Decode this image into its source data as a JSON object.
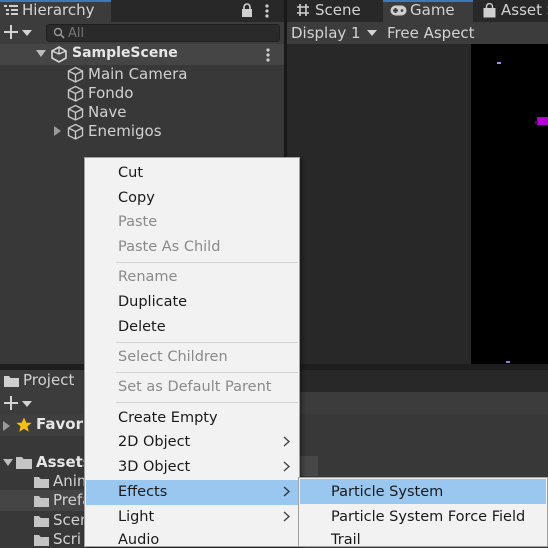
{
  "hierarchy": {
    "tab_title": "Hierarchy",
    "search_placeholder": "All",
    "scene_name": "SampleScene",
    "items": [
      {
        "label": "Main Camera"
      },
      {
        "label": "Fondo"
      },
      {
        "label": "Nave"
      },
      {
        "label": "Enemigos",
        "has_children": true
      }
    ]
  },
  "scene_panel": {
    "tabs": [
      {
        "label": "Scene",
        "icon": "hash-grid-icon"
      },
      {
        "label": "Game",
        "icon": "gamepad-icon",
        "active": true
      },
      {
        "label": "Asset S",
        "icon": "shopping-bag-icon"
      }
    ],
    "display": "Display 1",
    "aspect": "Free Aspect"
  },
  "project": {
    "tab_title": "Project",
    "favorites_label": "Favori",
    "assets_label": "Assets",
    "folders": [
      {
        "label": "Anim"
      },
      {
        "label": "Prefa",
        "selected": true
      },
      {
        "label": "Scen"
      },
      {
        "label": "Scri"
      }
    ]
  },
  "context_menu": {
    "items": [
      {
        "label": "Cut",
        "enabled": true
      },
      {
        "label": "Copy",
        "enabled": true
      },
      {
        "label": "Paste",
        "enabled": false
      },
      {
        "label": "Paste As Child",
        "enabled": false
      },
      {
        "label": "Rename",
        "enabled": false
      },
      {
        "label": "Duplicate",
        "enabled": true
      },
      {
        "label": "Delete",
        "enabled": true
      },
      {
        "label": "Select Children",
        "enabled": false
      },
      {
        "label": "Set as Default Parent",
        "enabled": false
      },
      {
        "label": "Create Empty",
        "enabled": true
      },
      {
        "label": "2D Object",
        "enabled": true,
        "submenu": true
      },
      {
        "label": "3D Object",
        "enabled": true,
        "submenu": true
      },
      {
        "label": "Effects",
        "enabled": true,
        "submenu": true,
        "highlighted": true
      },
      {
        "label": "Light",
        "enabled": true,
        "submenu": true
      },
      {
        "label": "Audio",
        "enabled": true,
        "submenu": true
      }
    ]
  },
  "effects_submenu": {
    "items": [
      {
        "label": "Particle System",
        "highlighted": true
      },
      {
        "label": "Particle System Force Field"
      },
      {
        "label": "Trail"
      }
    ]
  },
  "colors": {
    "accent": "#3a79bb",
    "menu_highlight": "#99c7f0",
    "game_view_background": "#000000",
    "sprite_color": "#b400d4"
  }
}
